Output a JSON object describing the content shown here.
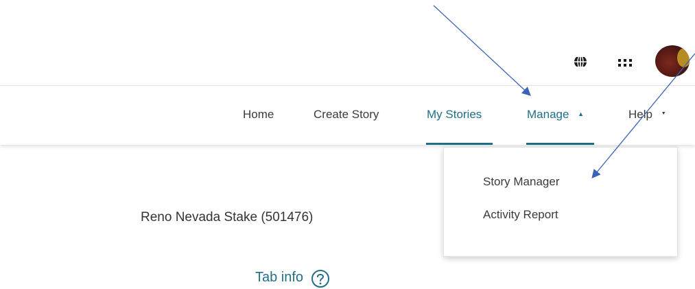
{
  "header": {
    "utility_icons": [
      "globe-icon",
      "apps-grid-icon"
    ],
    "avatar_alt": "user avatar"
  },
  "nav": {
    "items": [
      {
        "label": "Home",
        "active": false
      },
      {
        "label": "Create Story",
        "active": false
      },
      {
        "label": "My Stories",
        "active": true
      },
      {
        "label": "Manage",
        "active": true,
        "caret": "▲"
      },
      {
        "label": "Help",
        "active": false,
        "caret": "▼"
      }
    ]
  },
  "dropdown": {
    "items": [
      {
        "label": "Story Manager"
      },
      {
        "label": "Activity Report"
      }
    ]
  },
  "content": {
    "unit_name": "Reno Nevada Stake (501476)",
    "tab_info_label": "Tab info"
  },
  "colors": {
    "accent": "#1f6f86",
    "text": "#333333",
    "annotation_arrow": "#3b63b8"
  }
}
